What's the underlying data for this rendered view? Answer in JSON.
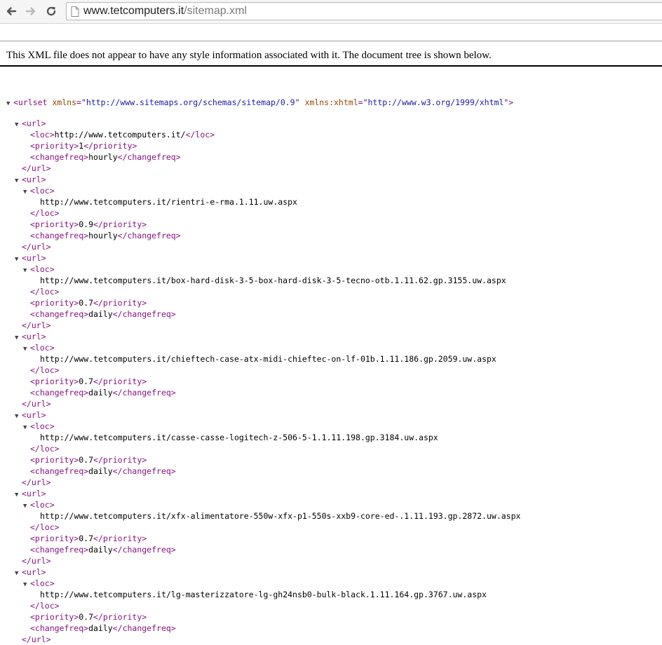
{
  "browser": {
    "url_host": "www.tetcomputers.it",
    "url_path": "/sitemap.xml",
    "icons": {
      "back": "back-arrow-icon",
      "forward": "forward-arrow-icon",
      "reload": "reload-icon",
      "page": "page-icon"
    }
  },
  "colors": {
    "tag": "#881280",
    "attr_name": "#994500",
    "attr_value": "#1a1aa6"
  },
  "info_message": "This XML file does not appear to have any style information associated with it. The document tree is shown below.",
  "xml": {
    "root_open_prefix": "<urlset",
    "root_open_suffix": ">",
    "root_attrs": [
      {
        "name": "xmlns",
        "value": "\"http://www.sitemaps.org/schemas/sitemap/0.9\""
      },
      {
        "name": "xmlns:xhtml",
        "value": "\"http://www.w3.org/1999/xhtml\""
      }
    ],
    "tags": {
      "url_open": "<url>",
      "url_close": "</url>",
      "loc_open": "<loc>",
      "loc_close": "</loc>",
      "priority_open": "<priority>",
      "priority_close": "</priority>",
      "changefreq_open": "<changefreq>",
      "changefreq_close": "</changefreq>"
    },
    "urls": [
      {
        "inline": true,
        "loc": "http://www.tetcomputers.it/",
        "priority": "1",
        "changefreq": "hourly"
      },
      {
        "inline": false,
        "loc": "http://www.tetcomputers.it/rientri-e-rma.1.11.uw.aspx",
        "priority": "0.9",
        "changefreq": "hourly"
      },
      {
        "inline": false,
        "loc": "http://www.tetcomputers.it/box-hard-disk-3-5-box-hard-disk-3-5-tecno-otb.1.11.62.gp.3155.uw.aspx",
        "priority": "0.7",
        "changefreq": "daily"
      },
      {
        "inline": false,
        "loc": "http://www.tetcomputers.it/chieftech-case-atx-midi-chieftec-on-lf-01b.1.11.186.gp.2059.uw.aspx",
        "priority": "0.7",
        "changefreq": "daily"
      },
      {
        "inline": false,
        "loc": "http://www.tetcomputers.it/casse-casse-logitech-z-506-5-1.1.11.198.gp.3184.uw.aspx",
        "priority": "0.7",
        "changefreq": "daily"
      },
      {
        "inline": false,
        "loc": "http://www.tetcomputers.it/xfx-alimentatore-550w-xfx-p1-550s-xxb9-core-ed-.1.11.193.gp.2872.uw.aspx",
        "priority": "0.7",
        "changefreq": "daily"
      },
      {
        "inline": false,
        "loc": "http://www.tetcomputers.it/lg-masterizzatore-lg-gh24nsb0-bulk-black.1.11.164.gp.3767.uw.aspx",
        "priority": "0.7",
        "changefreq": "daily"
      }
    ]
  }
}
